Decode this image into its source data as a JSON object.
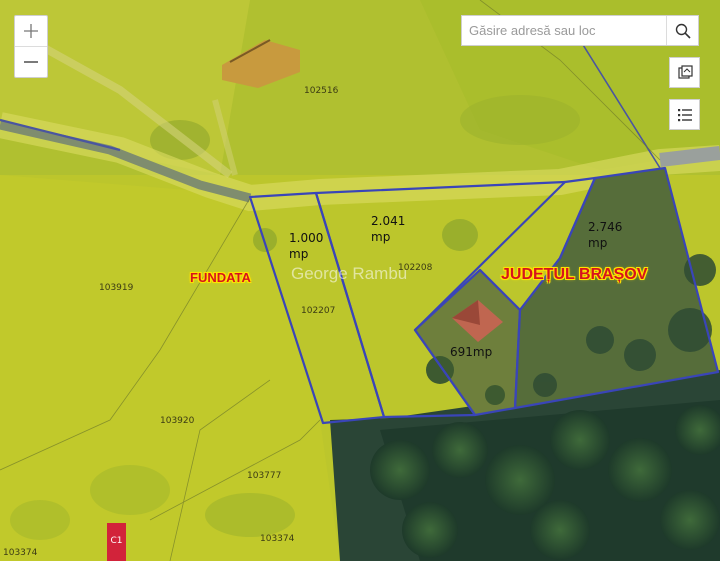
{
  "map": {
    "parcel_ids": [
      "102516",
      "103919",
      "102207",
      "102208",
      "103920",
      "103777",
      "103374",
      "103374"
    ],
    "parcel_areas": [
      {
        "line1": "1.000",
        "line2": "mp"
      },
      {
        "line1": "2.041",
        "line2": "mp"
      },
      {
        "line1": "2.746",
        "line2": "mp"
      },
      {
        "line1": "691mp",
        "line2": ""
      }
    ],
    "place_labels": [
      "FUNDATA",
      "JUDEȚUL BRAȘOV"
    ],
    "watermark": "George Rambu",
    "marker_label": "C1",
    "colors": {
      "overlay_yellow": "#c4cc2a",
      "boundary_blue": "#3a45b8",
      "road": "#8c9290",
      "forest": "#2f4c38",
      "place_label_red": "#d6141c"
    }
  },
  "controls": {
    "zoom_in_icon": "plus-icon",
    "zoom_out_icon": "minus-icon",
    "search_placeholder": "Găsire adresă sau loc",
    "search_icon": "search-icon",
    "basemap_icon": "map-layers-icon",
    "legend_icon": "list-icon"
  }
}
